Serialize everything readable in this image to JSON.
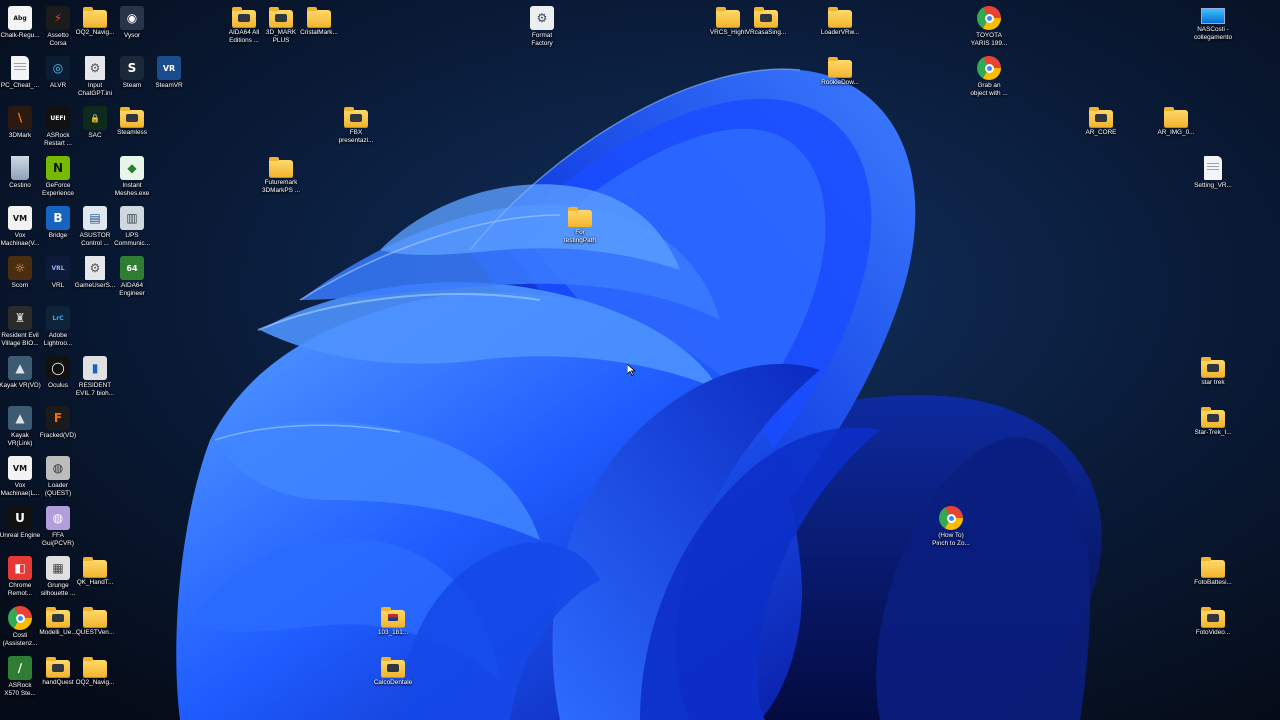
{
  "desktop": {
    "icons": [
      {
        "label": "Chalk-Regu...",
        "kind": "app",
        "glyph": "Abg",
        "bg": "#f5f5f5",
        "fg": "#111111",
        "icon": "font-sample-icon"
      },
      {
        "label": "Assetto\nCorsa",
        "kind": "app",
        "glyph": "⚡",
        "bg": "#1b1b1b",
        "fg": "#e53935",
        "icon": "assetto-corsa-icon"
      },
      {
        "label": "OQ2_Navig...",
        "kind": "folder",
        "icon": "folder-icon"
      },
      {
        "label": "Vysor",
        "kind": "app",
        "glyph": "◉",
        "bg": "#273449",
        "fg": "#ffffff",
        "icon": "vysor-icon"
      },
      {
        "label": "PC_Cheat_...",
        "kind": "doc",
        "icon": "document-icon"
      },
      {
        "label": "ALVR",
        "kind": "app",
        "glyph": "◎",
        "bg": "#0b1d33",
        "fg": "#4fc3f7",
        "icon": "alvr-icon"
      },
      {
        "label": "Input\nChatGPT.ini",
        "kind": "gear",
        "glyph": "⚙",
        "icon": "ini-settings-icon"
      },
      {
        "label": "Steam",
        "kind": "app",
        "glyph": "S",
        "bg": "#1b2838",
        "fg": "#ffffff",
        "icon": "steam-icon"
      },
      {
        "label": "SteamVR",
        "kind": "app",
        "glyph": "VR",
        "bg": "#1a4d8f",
        "fg": "#ffffff",
        "icon": "steamvr-icon"
      },
      {
        "label": "3DMark",
        "kind": "app",
        "glyph": "∖",
        "bg": "#2a1a12",
        "fg": "#ff7a1a",
        "icon": "3dmark-icon"
      },
      {
        "label": "ASRock\nRestart ...",
        "kind": "app",
        "glyph": "UEFI",
        "bg": "#111111",
        "fg": "#ffffff",
        "icon": "uefi-icon"
      },
      {
        "label": "SAC",
        "kind": "app",
        "glyph": "🔒",
        "bg": "#0d2a1a",
        "fg": "#7bff9a",
        "icon": "lock-icon"
      },
      {
        "label": "Steamless",
        "kind": "folder-app",
        "icon": "folder-icon"
      },
      {
        "label": "Cestino",
        "kind": "recycle",
        "glyph": "",
        "icon": "recycle-bin-icon"
      },
      {
        "label": "GeForce\nExperience",
        "kind": "app",
        "glyph": "N",
        "bg": "#76b900",
        "fg": "#0b1a00",
        "icon": "geforce-icon"
      },
      {
        "label": "Instant\nMeshes.exe",
        "kind": "app",
        "glyph": "◆",
        "bg": "#e8f5e9",
        "fg": "#2e7d32",
        "icon": "instant-meshes-icon"
      },
      {
        "label": "Vox\nMachinae(V...",
        "kind": "app",
        "glyph": "VM",
        "bg": "#f2f2f2",
        "fg": "#111111",
        "icon": "vox-machinae-icon"
      },
      {
        "label": "Bridge",
        "kind": "app",
        "glyph": "B",
        "bg": "#1565c0",
        "fg": "#ffffff",
        "icon": "bridge-icon"
      },
      {
        "label": "ASUSTOR\nControl ...",
        "kind": "app",
        "glyph": "▤",
        "bg": "#dfe7ef",
        "fg": "#1f4e8c",
        "icon": "asustor-icon"
      },
      {
        "label": "UPS\nCommunic...",
        "kind": "app",
        "glyph": "▥",
        "bg": "#cfd8dc",
        "fg": "#37474f",
        "icon": "ups-icon"
      },
      {
        "label": "Scorn",
        "kind": "app",
        "glyph": "☼",
        "bg": "#4a2c10",
        "fg": "#f0b060",
        "icon": "scorn-icon"
      },
      {
        "label": "VRL",
        "kind": "app",
        "glyph": "VRL",
        "bg": "#0e1a3a",
        "fg": "#8fb3ff",
        "icon": "vrl-icon"
      },
      {
        "label": "GameUserS...",
        "kind": "gear",
        "glyph": "⚙",
        "icon": "settings-file-icon"
      },
      {
        "label": "AIDA64\nEngineer",
        "kind": "app",
        "glyph": "64",
        "bg": "#2e7d32",
        "fg": "#ffffff",
        "icon": "aida64-icon"
      },
      {
        "label": "Resident Evil\nVillage BIO...",
        "kind": "app",
        "glyph": "♜",
        "bg": "#2b2b2b",
        "fg": "#d0d0d0",
        "icon": "resident-evil-icon"
      },
      {
        "label": "Adobe\nLightroo...",
        "kind": "app",
        "glyph": "LrC",
        "bg": "#0d2438",
        "fg": "#39a8ff",
        "icon": "lightroom-icon"
      },
      {
        "label": "Kayak VR(VD)",
        "kind": "app",
        "glyph": "▲",
        "bg": "#3d5a73",
        "fg": "#e0e0e0",
        "icon": "kayak-vr-icon"
      },
      {
        "label": "Oculus",
        "kind": "app",
        "glyph": "◯",
        "bg": "#111111",
        "fg": "#ffffff",
        "icon": "oculus-icon"
      },
      {
        "label": "RESIDENT\nEVIL 7 bioh...",
        "kind": "app",
        "glyph": "▮",
        "bg": "#e0e0e0",
        "fg": "#1565c0",
        "icon": "resident-evil-7-icon"
      },
      {
        "label": "Kayak\nVR(Link)",
        "kind": "app",
        "glyph": "▲",
        "bg": "#3d5a73",
        "fg": "#e0e0e0",
        "icon": "kayak-vr-link-icon"
      },
      {
        "label": "Fracked(VD)",
        "kind": "app",
        "glyph": "F",
        "bg": "#1b1b1b",
        "fg": "#ff6d00",
        "icon": "fracked-icon"
      },
      {
        "label": "Vox\nMachinae(L...",
        "kind": "app",
        "glyph": "VM",
        "bg": "#f2f2f2",
        "fg": "#111111",
        "icon": "vox-machinae-link-icon"
      },
      {
        "label": "Loader\n(QUEST)",
        "kind": "app",
        "glyph": "◍",
        "bg": "#bdbdbd",
        "fg": "#333333",
        "icon": "loader-quest-icon"
      },
      {
        "label": "Unreal Engine",
        "kind": "app",
        "glyph": "U",
        "bg": "#111111",
        "fg": "#ffffff",
        "icon": "unreal-engine-icon"
      },
      {
        "label": "FFA\nGui(PCVR)",
        "kind": "app",
        "glyph": "◍",
        "bg": "#b39ddb",
        "fg": "#ffffff",
        "icon": "ffa-gui-icon"
      },
      {
        "label": "Chrome\nRemot...",
        "kind": "app",
        "glyph": "◧",
        "bg": "#e53935",
        "fg": "#ffffff",
        "icon": "chrome-remote-icon"
      },
      {
        "label": "Grunge\nsilhouette ...",
        "kind": "app",
        "glyph": "▦",
        "bg": "#e0e0e0",
        "fg": "#424242",
        "icon": "grunge-silhouette-icon"
      },
      {
        "label": "QK_HandT...",
        "kind": "folder",
        "icon": "folder-icon"
      },
      {
        "label": "Costi\n(Assistenz...",
        "kind": "chrome",
        "icon": "chrome-icon"
      },
      {
        "label": "Modelli_Ue...",
        "kind": "folder-app",
        "icon": "folder-icon"
      },
      {
        "label": "QUESTVen...",
        "kind": "folder",
        "icon": "folder-icon"
      },
      {
        "label": "ASRock\nX570 Ste...",
        "kind": "app",
        "glyph": "∕",
        "bg": "#2e7d32",
        "fg": "#ffffff",
        "icon": "asrock-icon"
      },
      {
        "label": "handQuest",
        "kind": "folder-app",
        "icon": "folder-icon"
      },
      {
        "label": "OQ2_Navig...",
        "kind": "folder",
        "icon": "folder-icon"
      },
      {
        "label": "AIDA64 All\nEditions ...",
        "kind": "folder-app",
        "icon": "folder-icon"
      },
      {
        "label": "3D_MARK\nPLUS",
        "kind": "folder-app",
        "icon": "folder-icon"
      },
      {
        "label": "CristalMark...",
        "kind": "folder",
        "icon": "folder-icon"
      },
      {
        "label": "FBX\npresentazi...",
        "kind": "folder-app",
        "icon": "folder-icon"
      },
      {
        "label": "Futuremark\n3DMarkPS ...",
        "kind": "folder",
        "icon": "folder-icon"
      },
      {
        "label": "Format\nFactory",
        "kind": "app",
        "glyph": "⚙",
        "bg": "#eceff1",
        "fg": "#37474f",
        "icon": "format-factory-icon"
      },
      {
        "label": "For\ntestingPath",
        "kind": "folder",
        "icon": "folder-icon"
      },
      {
        "label": "VRCS_Hight",
        "kind": "folder",
        "icon": "folder-icon"
      },
      {
        "label": "VRcasaSing...",
        "kind": "folder-app",
        "icon": "folder-icon"
      },
      {
        "label": "LoaderVRw...",
        "kind": "folder",
        "icon": "folder-icon"
      },
      {
        "label": "RookieDow...",
        "kind": "folder",
        "icon": "folder-icon"
      },
      {
        "label": "TOYOTA\nYARIS 199...",
        "kind": "chrome",
        "icon": "chrome-icon"
      },
      {
        "label": "Grab an\nobject with ...",
        "kind": "chrome",
        "icon": "chrome-icon"
      },
      {
        "label": "(How To)\nPinch to Zo...",
        "kind": "chrome",
        "icon": "chrome-icon"
      },
      {
        "label": "103_1b1...",
        "kind": "folder-flag",
        "icon": "folder-icon"
      },
      {
        "label": "CalcoDentale",
        "kind": "folder-app",
        "icon": "folder-icon"
      },
      {
        "label": "NASCosti -\ncollegamento",
        "kind": "monitor",
        "icon": "network-monitor-icon"
      },
      {
        "label": "AR_CORE",
        "kind": "folder-app",
        "icon": "folder-icon"
      },
      {
        "label": "AR_IMG_0...",
        "kind": "folder",
        "icon": "folder-icon"
      },
      {
        "label": "Setting_VR...",
        "kind": "doc",
        "icon": "document-icon"
      },
      {
        "label": "star trek",
        "kind": "folder-app",
        "icon": "folder-icon"
      },
      {
        "label": "Star-Trek_I...",
        "kind": "folder-app",
        "icon": "folder-icon"
      },
      {
        "label": "FotoBattesi...",
        "kind": "folder",
        "icon": "folder-icon"
      },
      {
        "label": "FotoVideo...",
        "kind": "folder-app",
        "icon": "folder-icon"
      }
    ]
  }
}
